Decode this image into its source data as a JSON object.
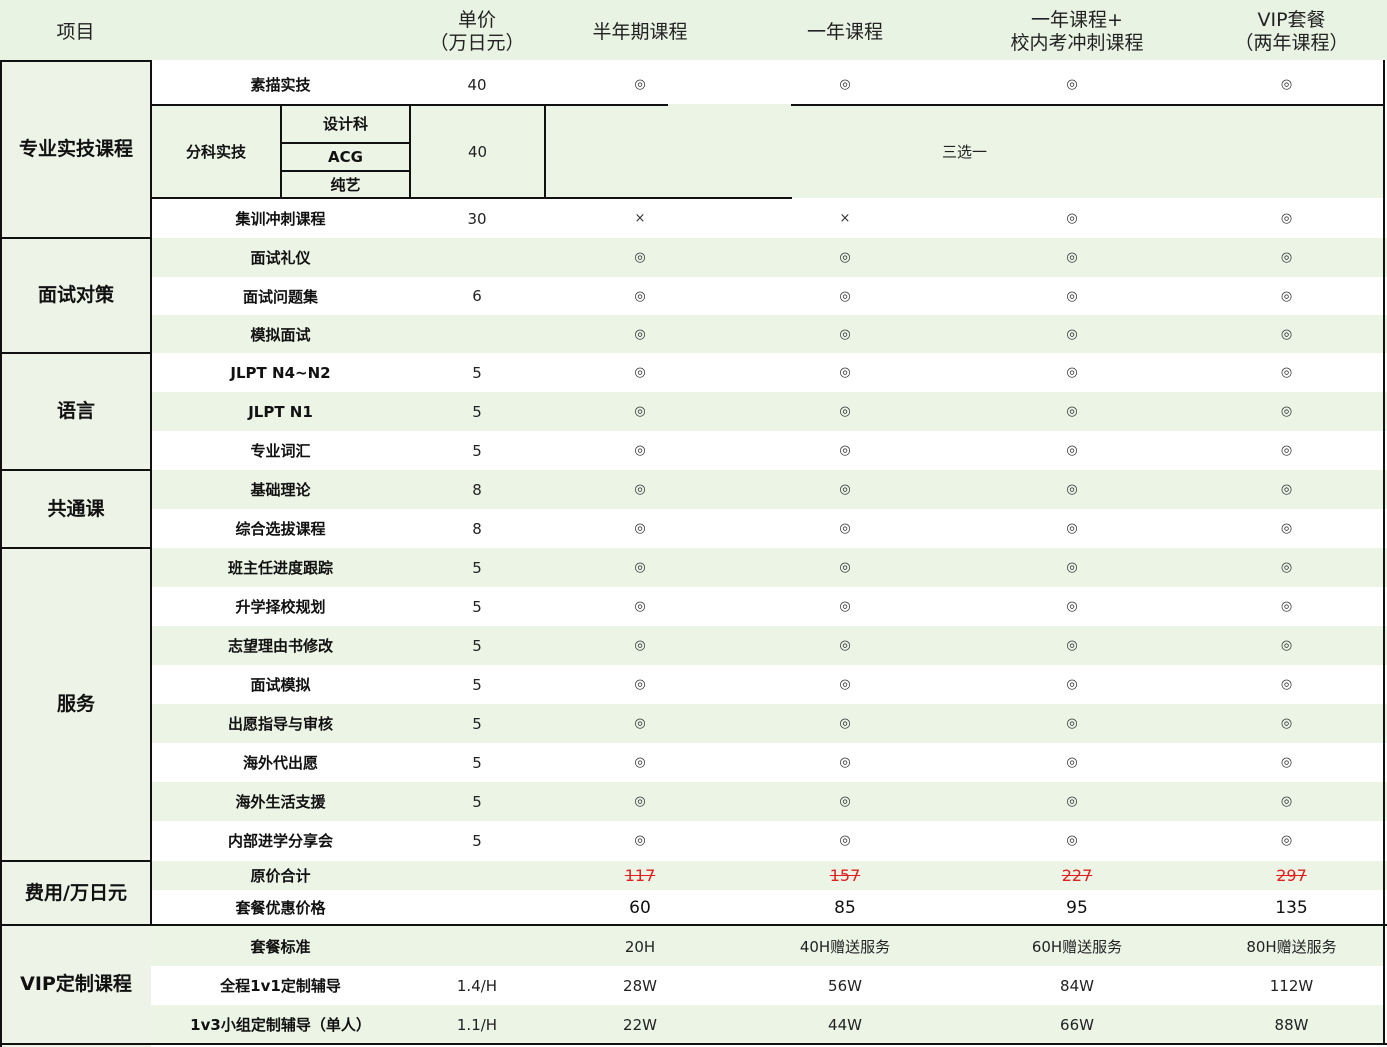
{
  "header": {
    "item": "项目",
    "price_line1": "单价",
    "price_line2": "（万日元）",
    "half_year": "半年期课程",
    "one_year": "一年课程",
    "plus_line1": "一年课程+",
    "plus_line2": "校内考冲刺课程",
    "vip_line1": "VIP套餐",
    "vip_line2": "（两年课程）"
  },
  "categories": {
    "professional": "专业实技课程",
    "interview": "面试对策",
    "language": "语言",
    "common": "共通课",
    "service": "服务",
    "fee": "费用/万日元",
    "vip_custom": "VIP定制课程"
  },
  "sketch": {
    "label": "素描实技",
    "price": "40",
    "marks": [
      "◎",
      "◎",
      "◎",
      "◎"
    ]
  },
  "subject": {
    "label": "分科实技",
    "subs": [
      "设计科",
      "ACG",
      "纯艺"
    ],
    "price": "40",
    "choice": "三选一"
  },
  "intensive": {
    "label": "集训冲刺课程",
    "price": "30",
    "marks": [
      "×",
      "×",
      "◎",
      "◎"
    ]
  },
  "interview_price": "6",
  "rows": [
    {
      "label": "面试礼仪",
      "marks": [
        "◎",
        "◎",
        "◎",
        "◎"
      ]
    },
    {
      "label": "面试问题集",
      "marks": [
        "◎",
        "◎",
        "◎",
        "◎"
      ]
    },
    {
      "label": "模拟面试",
      "marks": [
        "◎",
        "◎",
        "◎",
        "◎"
      ]
    },
    {
      "label": "JLPT N4~N2",
      "price": "5",
      "marks": [
        "◎",
        "◎",
        "◎",
        "◎"
      ]
    },
    {
      "label": "JLPT N1",
      "price": "5",
      "marks": [
        "◎",
        "◎",
        "◎",
        "◎"
      ]
    },
    {
      "label": "专业词汇",
      "price": "5",
      "marks": [
        "◎",
        "◎",
        "◎",
        "◎"
      ]
    },
    {
      "label": "基础理论",
      "price": "8",
      "marks": [
        "◎",
        "◎",
        "◎",
        "◎"
      ]
    },
    {
      "label": "综合选拔课程",
      "price": "8",
      "marks": [
        "◎",
        "◎",
        "◎",
        "◎"
      ]
    },
    {
      "label": "班主任进度跟踪",
      "price": "5",
      "marks": [
        "◎",
        "◎",
        "◎",
        "◎"
      ]
    },
    {
      "label": "升学择校规划",
      "price": "5",
      "marks": [
        "◎",
        "◎",
        "◎",
        "◎"
      ]
    },
    {
      "label": "志望理由书修改",
      "price": "5",
      "marks": [
        "◎",
        "◎",
        "◎",
        "◎"
      ]
    },
    {
      "label": "面试模拟",
      "price": "5",
      "marks": [
        "◎",
        "◎",
        "◎",
        "◎"
      ]
    },
    {
      "label": "出愿指导与审核",
      "price": "5",
      "marks": [
        "◎",
        "◎",
        "◎",
        "◎"
      ]
    },
    {
      "label": "海外代出愿",
      "price": "5",
      "marks": [
        "◎",
        "◎",
        "◎",
        "◎"
      ]
    },
    {
      "label": "海外生活支援",
      "price": "5",
      "marks": [
        "◎",
        "◎",
        "◎",
        "◎"
      ]
    },
    {
      "label": "内部进学分享会",
      "price": "5",
      "marks": [
        "◎",
        "◎",
        "◎",
        "◎"
      ]
    }
  ],
  "fees": {
    "original_label": "原价合计",
    "original": [
      "117",
      "157",
      "227",
      "297"
    ],
    "package_label": "套餐优惠价格",
    "package": [
      "60",
      "85",
      "95",
      "135"
    ]
  },
  "vip_rows": [
    {
      "label": "套餐标准",
      "price": "",
      "values": [
        "20H",
        "40H赠送服务",
        "60H赠送服务",
        "80H赠送服务"
      ]
    },
    {
      "label": "全程1v1定制辅导",
      "price": "1.4/H",
      "values": [
        "28W",
        "56W",
        "84W",
        "112W"
      ]
    },
    {
      "label": "1v3小组定制辅导（单人）",
      "price": "1.1/H",
      "values": [
        "22W",
        "44W",
        "66W",
        "88W"
      ]
    }
  ],
  "colors": {
    "band": "#ecf4e6",
    "header": "#ffffff",
    "border": "#111111",
    "strike": "#e02020"
  }
}
